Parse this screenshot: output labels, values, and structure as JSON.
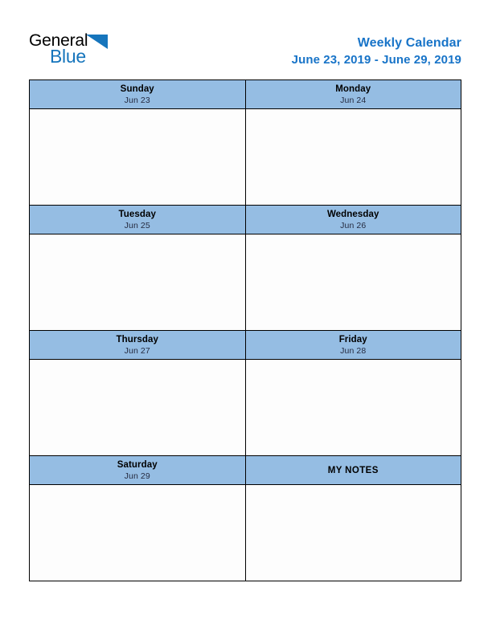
{
  "logo": {
    "word_one": "General",
    "word_two": "Blue",
    "triangle_icon": "triangle-icon",
    "brand_blue": "#1675BC"
  },
  "header": {
    "title": "Weekly Calendar",
    "date_range": "June 23, 2019 - June 29, 2019",
    "title_color": "#1874C8"
  },
  "colors": {
    "header_cell_blue": "#95BDE3",
    "grid_border": "#000000",
    "body_cell": "#FDFDFD",
    "day_name": "#000000",
    "day_date": "#252B40"
  },
  "calendar": {
    "rows": [
      {
        "cells": [
          {
            "name": "Sunday",
            "date": "Jun 23"
          },
          {
            "name": "Monday",
            "date": "Jun 24"
          }
        ]
      },
      {
        "cells": [
          {
            "name": "Tuesday",
            "date": "Jun 25"
          },
          {
            "name": "Wednesday",
            "date": "Jun 26"
          }
        ]
      },
      {
        "cells": [
          {
            "name": "Thursday",
            "date": "Jun 27"
          },
          {
            "name": "Friday",
            "date": "Jun 28"
          }
        ]
      },
      {
        "cells": [
          {
            "name": "Saturday",
            "date": "Jun 29"
          },
          {
            "name": "MY NOTES",
            "date": ""
          }
        ]
      }
    ]
  }
}
